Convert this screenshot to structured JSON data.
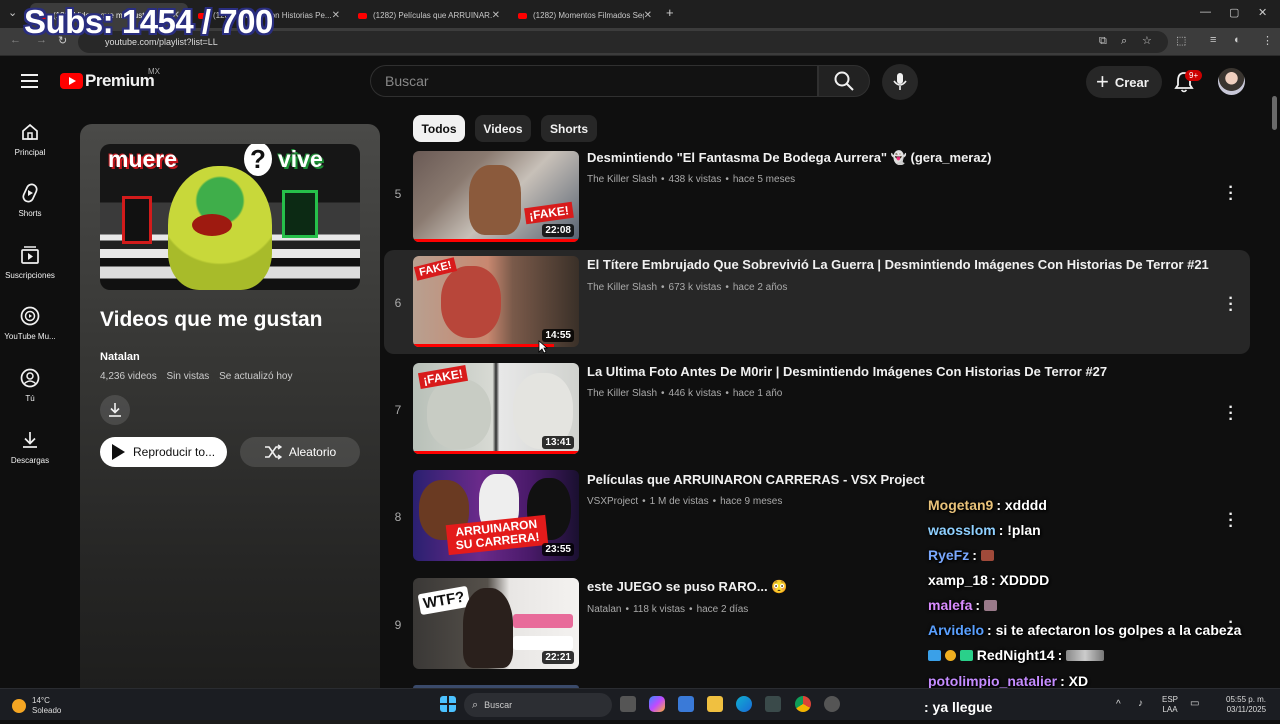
{
  "overlay": {
    "subs_text": "Subs: 1454 / 700"
  },
  "browser": {
    "tabs": [
      {
        "title": "(128) Videos que me gustan",
        "active": true
      },
      {
        "title": "(1282) Videos Con Historias Pe..."
      },
      {
        "title": "(1282) Películas que ARRUINAR..."
      },
      {
        "title": "(1282) Momentos Filmados Seg..."
      }
    ],
    "new_tab": "+",
    "url": "youtube.com/playlist?list=LL"
  },
  "header": {
    "logo_text": "Premium",
    "region": "MX",
    "search_placeholder": "Buscar",
    "create_label": "Crear",
    "notif_badge": "9+"
  },
  "sidebar": {
    "items": [
      {
        "label": "Principal",
        "icon": "home-icon"
      },
      {
        "label": "Shorts",
        "icon": "shorts-icon"
      },
      {
        "label": "Suscripciones",
        "icon": "subscriptions-icon"
      },
      {
        "label": "YouTube Mu...",
        "icon": "music-icon"
      },
      {
        "label": "Tú",
        "icon": "you-icon"
      },
      {
        "label": "Descargas",
        "icon": "download-icon"
      }
    ]
  },
  "playlist": {
    "cover_left": "muere",
    "cover_mid": "?",
    "cover_right": "vive",
    "title": "Videos que me gustan",
    "owner": "Natalan",
    "video_count": "4,236 videos",
    "views": "Sin vistas",
    "updated": "Se actualizó hoy",
    "play_all": "Reproducir to...",
    "shuffle": "Aleatorio"
  },
  "chips": [
    "Todos",
    "Videos",
    "Shorts"
  ],
  "videos": [
    {
      "num": "5",
      "title": "Desmintiendo \"El Fantasma De Bodega Aurrera\" 👻 (gera_meraz)",
      "channel": "The Killer Slash",
      "views": "438 k vistas",
      "age": "hace 5 meses",
      "duration": "22:08",
      "thumb_text": "¡FAKE!",
      "progress": 1.0
    },
    {
      "num": "6",
      "title": "El Títere Embrujado Que Sobrevivió La Guerra | Desmintiendo Imágenes Con Historias De Terror #21",
      "channel": "The Killer Slash",
      "views": "673 k vistas",
      "age": "hace 2 años",
      "duration": "14:55",
      "thumb_text": "FAKE!",
      "progress": 0.85
    },
    {
      "num": "7",
      "title": "La Ultima Foto Antes De M0rir | Desmintiendo Imágenes Con Historias De Terror #27",
      "channel": "The Killer Slash",
      "views": "446 k vistas",
      "age": "hace 1 año",
      "duration": "13:41",
      "thumb_text": "¡FAKE!",
      "progress": 1.0
    },
    {
      "num": "8",
      "title": "Películas que ARRUINARON CARRERAS - VSX Project",
      "channel": "VSXProject",
      "views": "1 M de vistas",
      "age": "hace 9 meses",
      "duration": "23:55",
      "thumb_text": "ARRUINARON SU CARRERA!",
      "progress": 0.0
    },
    {
      "num": "9",
      "title": "este JUEGO se puso RARO... 😳",
      "channel": "Natalan",
      "views": "118 k vistas",
      "age": "hace 2 días",
      "duration": "22:21",
      "thumb_text": "WTF?",
      "progress": 0.0
    }
  ],
  "chat": [
    {
      "user": "Mogetan9",
      "color": "#e8c27a",
      "msg": ": xdddd"
    },
    {
      "user": "waosslom",
      "color": "#8fd0ff",
      "msg": ": !plan"
    },
    {
      "user": "RyeFz",
      "color": "#7aa8ff",
      "msg": ": ",
      "emote": true
    },
    {
      "user": "xamp_18",
      "color": "#ffffff",
      "msg": ": XDDDD"
    },
    {
      "user": "malefa",
      "color": "#d98cff",
      "msg": ": ",
      "emote": true
    },
    {
      "user": "Arvidelo",
      "color": "#5aa0ff",
      "msg": ": si te afectaron los golpes a la cabeza"
    },
    {
      "user": "RedNight14",
      "color": "#ffffff",
      "msg": ": ",
      "emote": true,
      "badges": true
    },
    {
      "user": "potolimpio_natalier",
      "color": "#c58cff",
      "msg": ": XD"
    },
    {
      "user": "",
      "color": "#ffffff",
      "msg": ": ya llegue"
    }
  ],
  "taskbar": {
    "temp": "14°C",
    "weather": "Soleado",
    "search": "Buscar",
    "lang1": "ESP",
    "lang2": "LAA",
    "time": "05:55 p. m.",
    "date": "03/11/2025"
  },
  "colors": {
    "accent": "#ff0000",
    "bg": "#0f0f0f",
    "hover_row": "#272727"
  }
}
